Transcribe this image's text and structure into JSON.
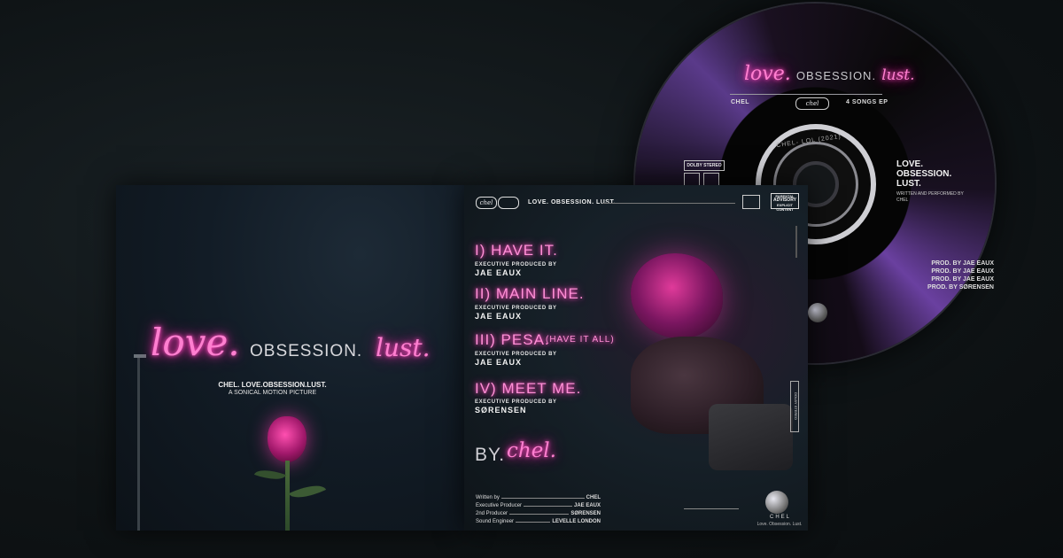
{
  "cd": {
    "title_love": "love.",
    "title_obsession": "OBSESSION.",
    "title_lust": "lust.",
    "artist": "CHEL",
    "ep": "4 SONGS EP",
    "ring_text": "CHEL- LOL (2021)",
    "side_title": [
      "LOVE.",
      "OBSESSION.",
      "LUST."
    ],
    "side_sub": "WRITTEN AND PERFORMED BY",
    "side_artist": "CHEL",
    "prod_lines": [
      "PROD. BY JAE EAUX",
      "PROD. BY JAE EAUX",
      "PROD. BY JAE EAUX",
      "PROD. BY SØRENSEN"
    ],
    "dolby": "DOLBY STEREO",
    "logo": "chel"
  },
  "left_page": {
    "title_love": "love.",
    "title_obsession": "OBSESSION.",
    "title_lust": "lust.",
    "subtitle1": "CHEL. LOVE.OBSESSION.LUST.",
    "subtitle2": "A SONICAL MOTION PICTURE"
  },
  "right_page": {
    "logo": "chel",
    "header_title": "LOVE. OBSESSION. LUST.",
    "advisory_top": "PARENTAL",
    "advisory_mid": "ADVISORY",
    "advisory_bot": "EXPLICIT CONTENT",
    "tracks": [
      {
        "title": "I) HAVE IT.",
        "extra": "",
        "sub": "EXECUTIVE PRODUCED BY",
        "producer": "JAE EAUX"
      },
      {
        "title": "II) MAIN LINE.",
        "extra": "",
        "sub": "EXECUTIVE PRODUCED BY",
        "producer": "JAE EAUX"
      },
      {
        "title": "III) PESA.",
        "extra": "(HAVE IT ALL)",
        "sub": "EXECUTIVE PRODUCED BY",
        "producer": "JAE EAUX"
      },
      {
        "title": "IV) MEET ME.",
        "extra": "",
        "sub": "EXECUTIVE PRODUCED BY",
        "producer": "SØRENSEN"
      }
    ],
    "by_label": "BY.",
    "by_name": "chel.",
    "credits": [
      {
        "role": "Written by",
        "name": "CHEL"
      },
      {
        "role": "Executive Producer",
        "name": "JAE EAUX"
      },
      {
        "role": "2nd Producer",
        "name": "SØRENSEN"
      },
      {
        "role": "Sound Engineer",
        "name": "LEVELLE LONDON"
      }
    ],
    "footer_brand": "CHEL",
    "footer_tagline": "Love. Obsession. Lust.",
    "dolby_vertical": "DOLBY STEREO"
  },
  "colors": {
    "neon_pink": "#ff7fd0",
    "background": "#0f1416"
  }
}
